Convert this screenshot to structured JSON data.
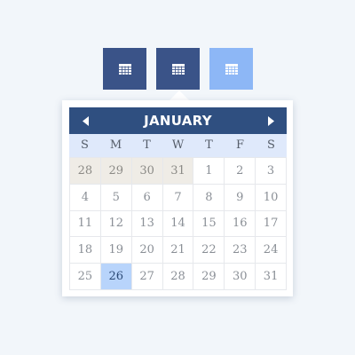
{
  "toolbar": {
    "buttons": [
      {
        "name": "calendar-button-1",
        "icon": "calendar-icon",
        "color": "#3a5388"
      },
      {
        "name": "calendar-button-2",
        "icon": "calendar-icon",
        "color": "#3a5388"
      },
      {
        "name": "calendar-button-3",
        "icon": "calendar-icon",
        "color": "#8db7f6"
      }
    ]
  },
  "calendar": {
    "month": "JANUARY",
    "prev_icon": "triangle-left-icon",
    "next_icon": "triangle-right-icon",
    "weekdays": [
      "S",
      "M",
      "T",
      "W",
      "T",
      "F",
      "S"
    ],
    "days": [
      {
        "label": "28",
        "state": "other"
      },
      {
        "label": "29",
        "state": "other"
      },
      {
        "label": "30",
        "state": "other"
      },
      {
        "label": "31",
        "state": "other"
      },
      {
        "label": "1",
        "state": "current"
      },
      {
        "label": "2",
        "state": "current"
      },
      {
        "label": "3",
        "state": "current"
      },
      {
        "label": "4",
        "state": "current"
      },
      {
        "label": "5",
        "state": "current"
      },
      {
        "label": "6",
        "state": "current"
      },
      {
        "label": "7",
        "state": "current"
      },
      {
        "label": "8",
        "state": "current"
      },
      {
        "label": "9",
        "state": "current"
      },
      {
        "label": "10",
        "state": "current"
      },
      {
        "label": "11",
        "state": "current"
      },
      {
        "label": "12",
        "state": "current"
      },
      {
        "label": "13",
        "state": "current"
      },
      {
        "label": "14",
        "state": "current"
      },
      {
        "label": "15",
        "state": "current"
      },
      {
        "label": "16",
        "state": "current"
      },
      {
        "label": "17",
        "state": "current"
      },
      {
        "label": "18",
        "state": "current"
      },
      {
        "label": "19",
        "state": "current"
      },
      {
        "label": "20",
        "state": "current"
      },
      {
        "label": "21",
        "state": "current"
      },
      {
        "label": "22",
        "state": "current"
      },
      {
        "label": "23",
        "state": "current"
      },
      {
        "label": "24",
        "state": "current"
      },
      {
        "label": "25",
        "state": "current"
      },
      {
        "label": "26",
        "state": "today"
      },
      {
        "label": "27",
        "state": "current"
      },
      {
        "label": "28",
        "state": "current"
      },
      {
        "label": "29",
        "state": "current"
      },
      {
        "label": "30",
        "state": "current"
      },
      {
        "label": "31",
        "state": "current"
      }
    ]
  },
  "colors": {
    "header": "#2f4f80",
    "weekday_row": "#dfe9fb",
    "today": "#b8d4fb",
    "other_month": "#efece6",
    "background": "#f2f6fa"
  }
}
